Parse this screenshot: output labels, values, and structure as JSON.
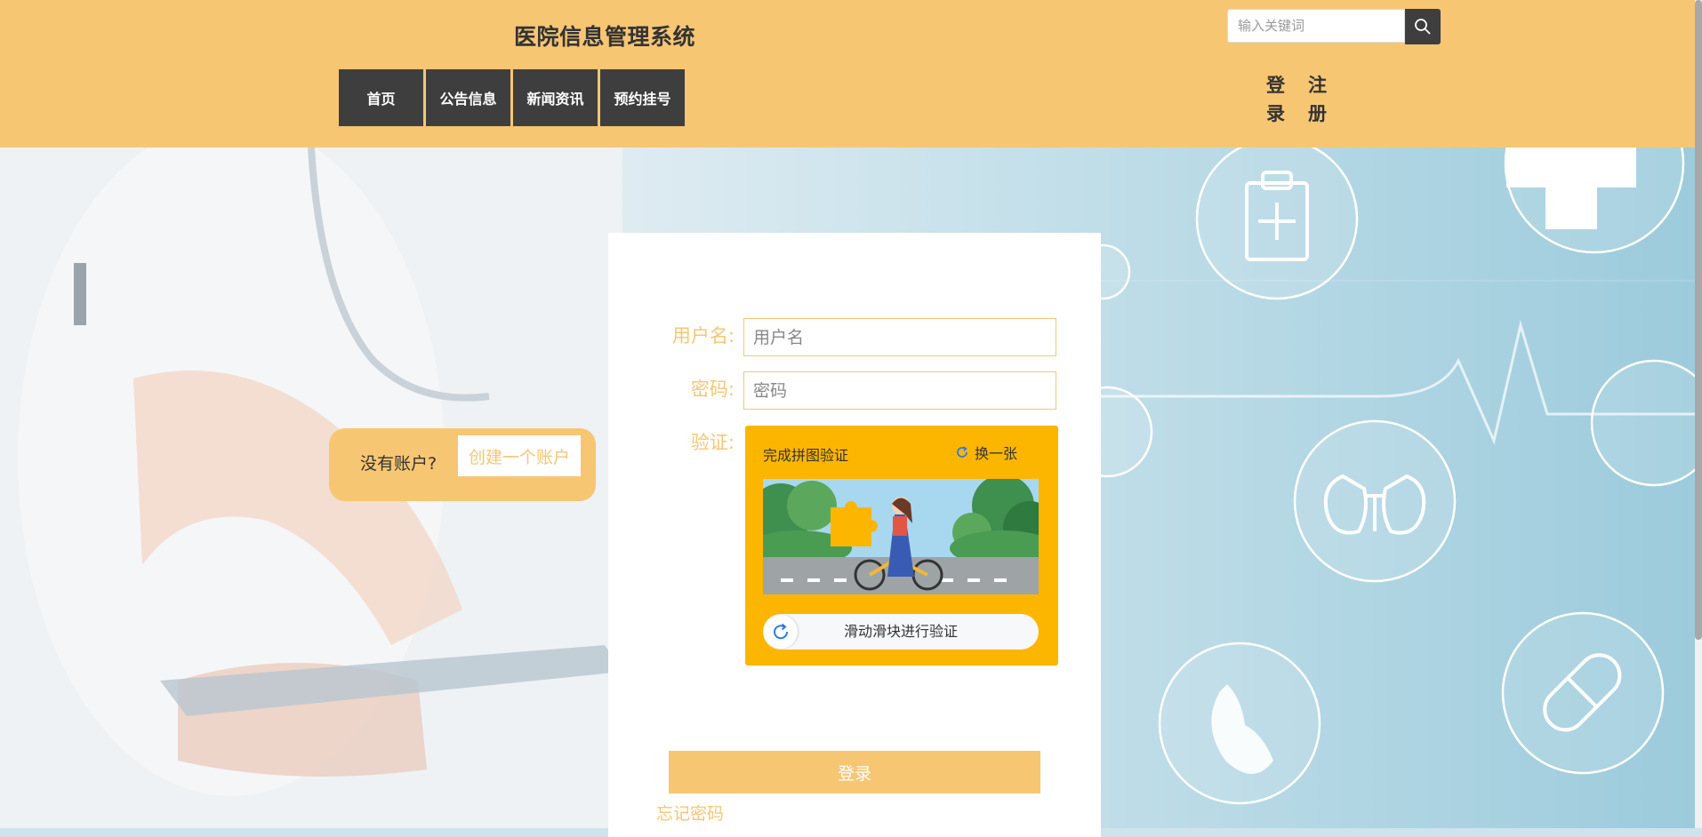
{
  "header": {
    "title": "医院信息管理系统",
    "nav": [
      "首页",
      "公告信息",
      "新闻资讯",
      "预约挂号"
    ],
    "search": {
      "placeholder": "输入关键词",
      "value": ""
    },
    "login_label": "登录",
    "register_label": "注册"
  },
  "signup_prompt": {
    "text": "没有账户?",
    "button_label": "创建一个账户"
  },
  "login_form": {
    "username_label": "用户名:",
    "username_placeholder": "用户名",
    "password_label": "密码:",
    "password_placeholder": "密码",
    "verify_label": "验证:",
    "captcha": {
      "title": "完成拼图验证",
      "refresh_label": "换一张",
      "slider_text": "滑动滑块进行验证"
    },
    "submit_label": "登录",
    "forgot_label": "忘记密码"
  },
  "colors": {
    "accent": "#f7c673",
    "nav_bg": "#3e3e3e",
    "captcha_bg": "#fdb600"
  }
}
